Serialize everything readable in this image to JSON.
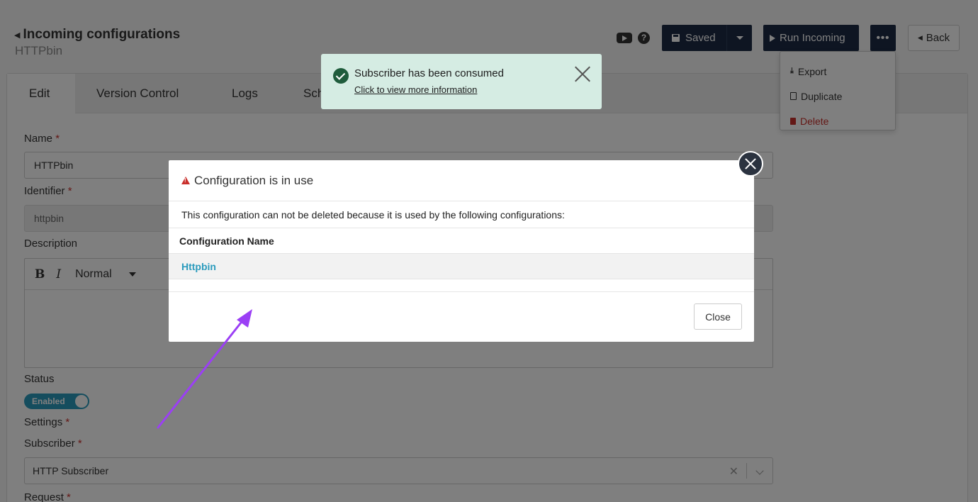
{
  "header": {
    "title": "Incoming configurations",
    "subtitle": "HTTPbin"
  },
  "toolbar": {
    "saved_label": "Saved",
    "run_label": "Run Incoming",
    "more_label": "•••",
    "back_label": "Back",
    "help_label": "?"
  },
  "more_menu": {
    "items": [
      {
        "label": "Export",
        "icon": "download-icon"
      },
      {
        "label": "Duplicate",
        "icon": "file-icon"
      },
      {
        "label": "Delete",
        "icon": "trash-icon"
      }
    ]
  },
  "tabs": [
    {
      "label": "Edit",
      "active": true
    },
    {
      "label": "Version Control",
      "active": false
    },
    {
      "label": "Logs",
      "active": false
    },
    {
      "label": "Sch",
      "active": false
    }
  ],
  "form": {
    "name_label": "Name",
    "name_value": "HTTPbin",
    "identifier_label": "Identifier",
    "identifier_value": "httpbin",
    "description_label": "Description",
    "editor_bold": "B",
    "editor_italic": "I",
    "editor_format": "Normal",
    "status_label": "Status",
    "status_value": "Enabled",
    "settings_label": "Settings",
    "subscriber_label": "Subscriber",
    "subscriber_value": "HTTP Subscriber",
    "subscriber_clear": "✕",
    "request_label": "Request",
    "required_mark": "*"
  },
  "toast": {
    "message": "Subscriber has been consumed",
    "link": "Click to view more information",
    "color": "#d5ece3"
  },
  "modal": {
    "title": "Configuration is in use",
    "message": "This configuration can not be deleted because it is used by the following configurations:",
    "column_header": "Configuration Name",
    "rows": [
      "Httpbin"
    ],
    "close_label": "Close"
  },
  "colors": {
    "primary_dark": "#1c2a44",
    "accent": "#2b9bbd",
    "danger": "#c9302c",
    "annotation_arrow": "#9b3ff5"
  }
}
